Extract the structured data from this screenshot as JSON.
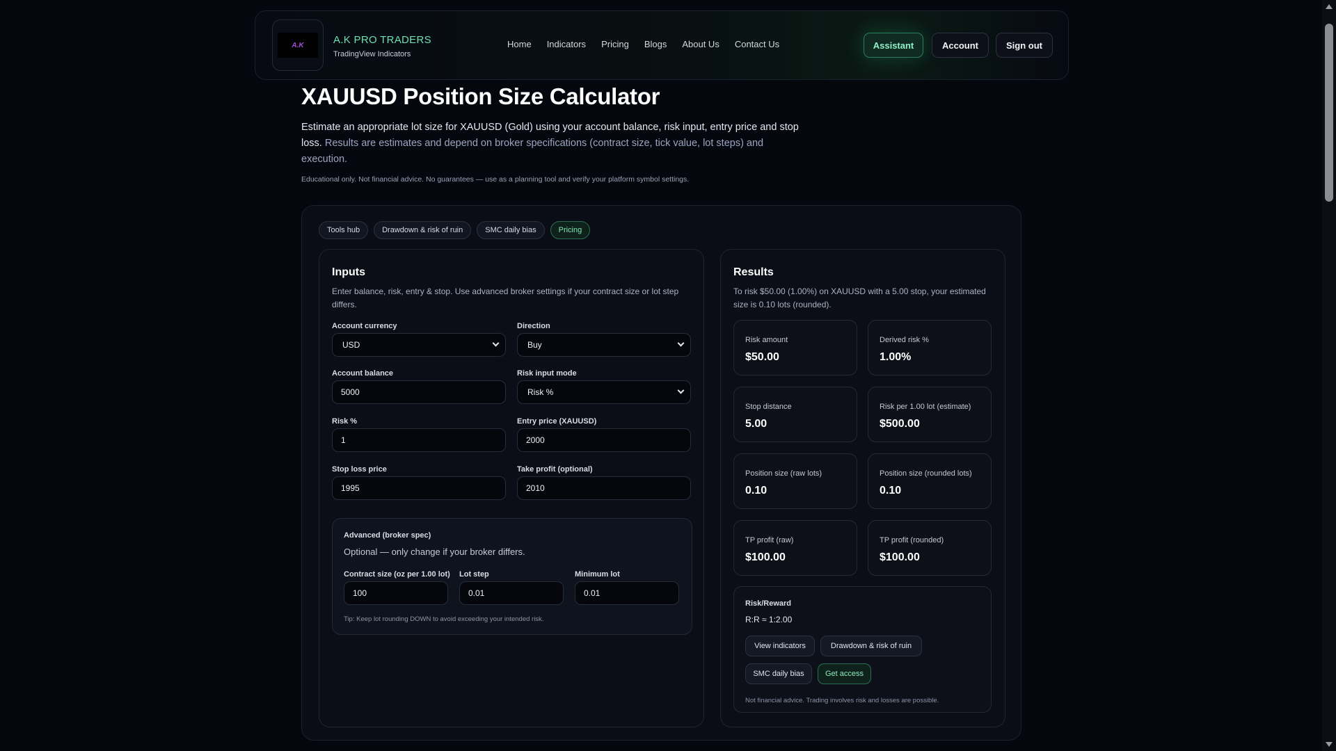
{
  "header": {
    "logo_text": "A.K",
    "brand_name": "A.K PRO TRADERS",
    "brand_sub": "TradingView Indicators",
    "nav": [
      "Home",
      "Indicators",
      "Pricing",
      "Blogs",
      "About Us",
      "Contact Us"
    ],
    "assistant_label": "Assistant",
    "account_label": "Account",
    "signout_label": "Sign out"
  },
  "hero": {
    "title": "XAUUSD Position Size Calculator",
    "desc_main": "Estimate an appropriate lot size for XAUUSD (Gold) using your account balance, risk input, entry price and stop loss.",
    "desc_muted": "Results are estimates and depend on broker specifications (contract size, tick value, lot steps) and execution.",
    "disclaimer": "Educational only. Not financial advice. No guarantees — use as a planning tool and verify your platform symbol settings."
  },
  "pills": [
    {
      "label": "Tools hub"
    },
    {
      "label": "Drawdown & risk of ruin"
    },
    {
      "label": "SMC daily bias"
    },
    {
      "label": "Pricing"
    }
  ],
  "inputs": {
    "title": "Inputs",
    "subtitle": "Enter balance, risk, entry & stop. Use advanced broker settings if your contract size or lot step differs.",
    "currency_label": "Account currency",
    "currency_value": "USD",
    "direction_label": "Direction",
    "direction_value": "Buy",
    "balance_label": "Account balance",
    "balance_value": "5000",
    "risk_mode_label": "Risk input mode",
    "risk_mode_value": "Risk %",
    "risk_pct_label": "Risk %",
    "risk_pct_value": "1",
    "entry_label": "Entry price (XAUUSD)",
    "entry_value": "2000",
    "sl_label": "Stop loss price",
    "sl_value": "1995",
    "tp_label": "Take profit (optional)",
    "tp_value": "2010",
    "advanced": {
      "title": "Advanced (broker spec)",
      "subtitle": "Optional — only change if your broker differs.",
      "contract_label": "Contract size (oz per 1.00 lot)",
      "contract_value": "100",
      "lot_step_label": "Lot step",
      "lot_step_value": "0.01",
      "min_lot_label": "Minimum lot",
      "min_lot_value": "0.01",
      "tip": "Tip: Keep lot rounding DOWN to avoid exceeding your intended risk."
    }
  },
  "results": {
    "title": "Results",
    "summary": "To risk $50.00 (1.00%) on XAUUSD with a 5.00 stop, your estimated size is 0.10 lots (rounded).",
    "stats": [
      {
        "label": "Risk amount",
        "value": "$50.00"
      },
      {
        "label": "Derived risk %",
        "value": "1.00%"
      },
      {
        "label": "Stop distance",
        "value": "5.00"
      },
      {
        "label": "Risk per 1.00 lot (estimate)",
        "value": "$500.00"
      },
      {
        "label": "Position size (raw lots)",
        "value": "0.10"
      },
      {
        "label": "Position size (rounded lots)",
        "value": "0.10"
      },
      {
        "label": "TP profit (raw)",
        "value": "$100.00"
      },
      {
        "label": "TP profit (rounded)",
        "value": "$100.00"
      }
    ],
    "rr_title": "Risk/Reward",
    "rr_value": "R:R ≈ 1:2.00",
    "rr_buttons": [
      "View indicators",
      "Drawdown & risk of ruin",
      "SMC daily bias",
      "Get access"
    ],
    "note": "Not financial advice. Trading involves risk and losses are possible."
  }
}
